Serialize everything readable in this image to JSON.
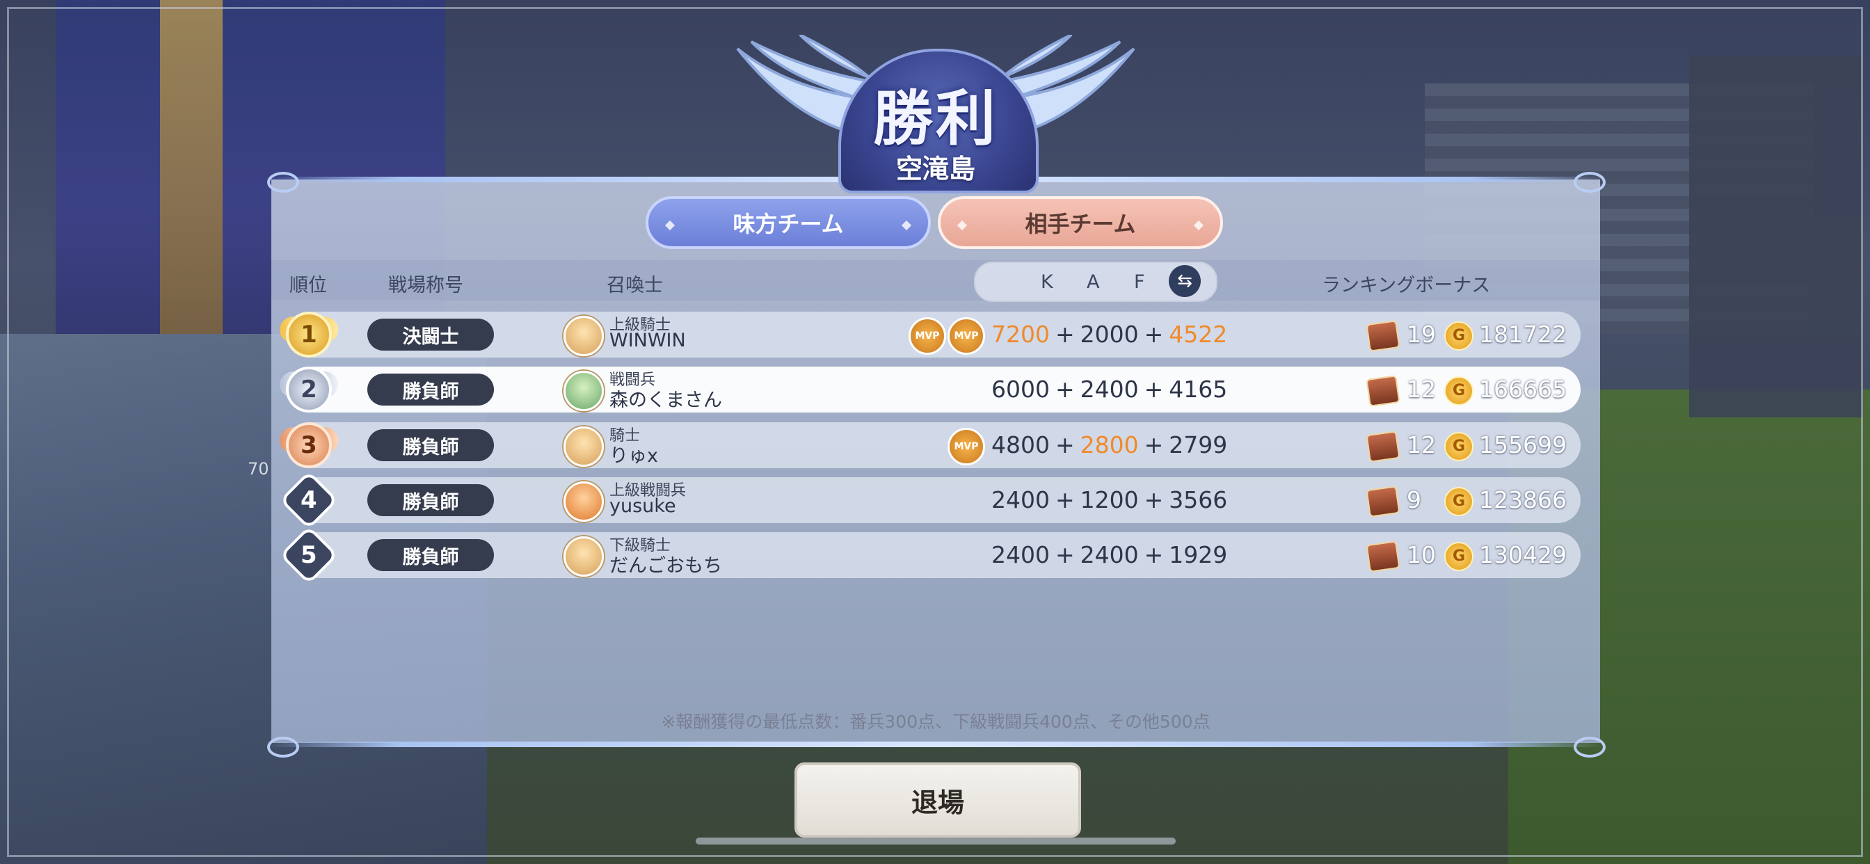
{
  "header": {
    "title": "勝利",
    "subtitle": "空滝島"
  },
  "tabs": {
    "ally": "味方チーム",
    "enemy": "相手チーム"
  },
  "columns": {
    "rank": "順位",
    "battle_title": "戦場称号",
    "summoner": "召喚士",
    "k": "K",
    "a": "A",
    "f": "F",
    "bonus": "ランキングボーナス"
  },
  "rows": [
    {
      "rank": "1",
      "title": "決闘士",
      "class": "上級騎士",
      "name": "WINWIN",
      "k": "7200",
      "a": "2000",
      "f": "4522",
      "chest": "19",
      "gold": "181722",
      "badges": [
        "MVP",
        "MVP"
      ]
    },
    {
      "rank": "2",
      "title": "勝負師",
      "class": "戦闘兵",
      "name": "森のくまさん",
      "k": "6000",
      "a": "2400",
      "f": "4165",
      "chest": "12",
      "gold": "166665",
      "badges": []
    },
    {
      "rank": "3",
      "title": "勝負師",
      "class": "騎士",
      "name": "りゅx",
      "k": "4800",
      "a": "2800",
      "f": "2799",
      "chest": "12",
      "gold": "155699",
      "badges": [
        "MVP"
      ]
    },
    {
      "rank": "4",
      "title": "勝負師",
      "class": "上級戦闘兵",
      "name": "yusuke",
      "k": "2400",
      "a": "1200",
      "f": "3566",
      "chest": "9",
      "gold": "123866",
      "badges": []
    },
    {
      "rank": "5",
      "title": "勝負師",
      "class": "下級騎士",
      "name": "だんごおもち",
      "k": "2400",
      "a": "2400",
      "f": "1929",
      "chest": "10",
      "gold": "130429",
      "badges": []
    }
  ],
  "plus": "+",
  "coin_symbol": "G",
  "note": "※報酬獲得の最低点数：番兵300点、下級戦闘兵400点、その他500点",
  "exit_label": "退場",
  "side_level": "70",
  "colors": {
    "highlight": "#f08a2a",
    "ally_tab": "#7f93e2",
    "enemy_tab": "#eeb4a6"
  }
}
